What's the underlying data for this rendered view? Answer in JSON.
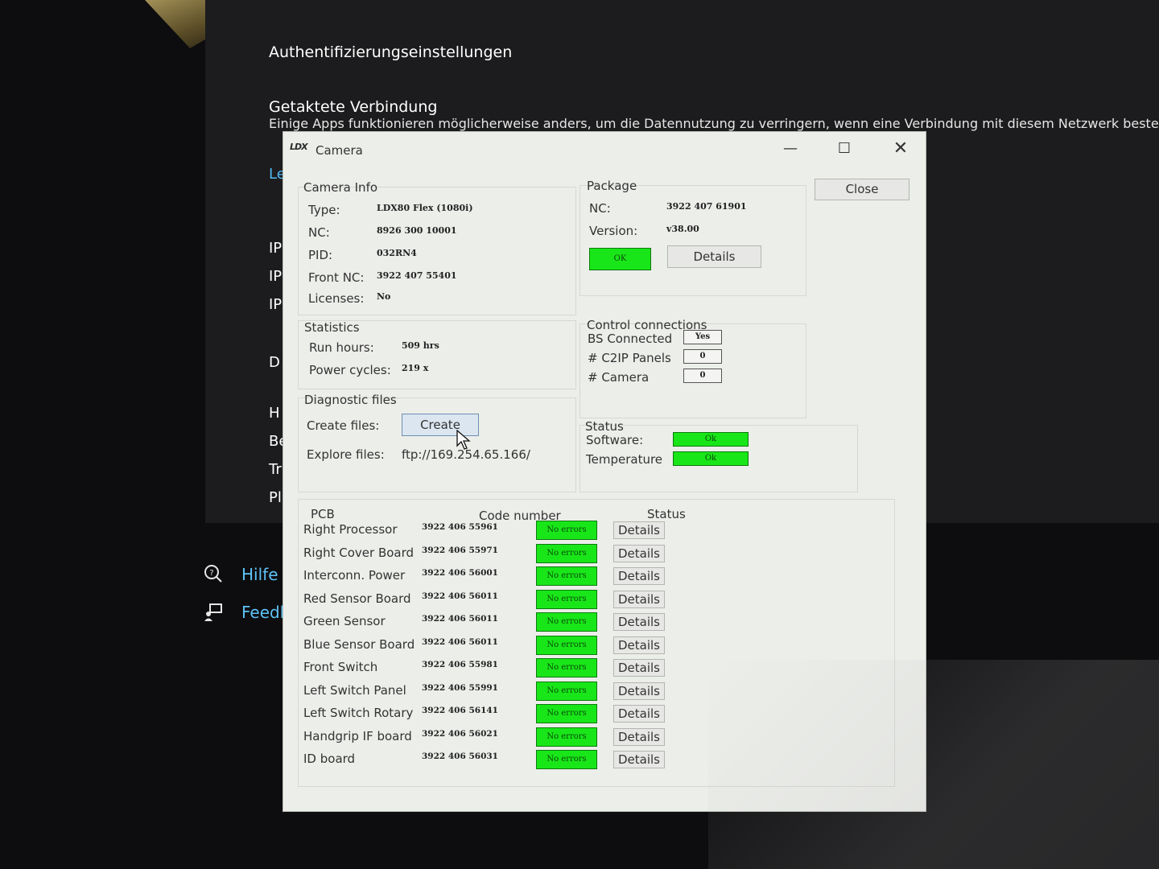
{
  "background": {
    "heading_auth": "Authentifizierungseinstellungen",
    "heading_metered": "Getaktete Verbindung",
    "metered_desc": "Einige Apps funktionieren möglicherweise anders, um die Datennutzung zu verringern, wenn eine Verbindung mit diesem Netzwerk besteht.",
    "side_items": [
      "Le",
      "IP",
      "IP",
      "IP",
      "D",
      "H",
      "Be",
      "Tr",
      "Pl"
    ],
    "help_link": "Hilfe a",
    "feedback_link": "Feedb"
  },
  "window": {
    "logo": "LDX",
    "title": "Camera",
    "minimize": "—",
    "maximize": "☐",
    "close": "✕"
  },
  "close_button": "Close",
  "camera_info": {
    "title": "Camera Info",
    "fields": [
      {
        "label": "Type:",
        "value": "LDX80 Flex (1080i)"
      },
      {
        "label": "NC:",
        "value": "8926 300 10001"
      },
      {
        "label": "PID:",
        "value": "032RN4"
      },
      {
        "label": "Front NC:",
        "value": "3922 407 55401"
      },
      {
        "label": "Licenses:",
        "value": "No"
      }
    ]
  },
  "package": {
    "title": "Package",
    "nc_label": "NC:",
    "nc_value": "3922 407 61901",
    "version_label": "Version:",
    "version_value": "v38.00",
    "status": "OK",
    "details": "Details"
  },
  "statistics": {
    "title": "Statistics",
    "run_hours_label": "Run hours:",
    "run_hours_value": "509 hrs",
    "power_cycles_label": "Power cycles:",
    "power_cycles_value": "219 x"
  },
  "control_connections": {
    "title": "Control connections",
    "bs_label": "BS Connected",
    "bs_value": "Yes",
    "c2ip_label": "# C2IP Panels",
    "c2ip_value": "0",
    "camera_label": "# Camera",
    "camera_value": "0"
  },
  "diagnostic": {
    "title": "Diagnostic files",
    "create_label": "Create files:",
    "create_button": "Create",
    "explore_label": "Explore files:",
    "explore_value": "ftp://169.254.65.166/"
  },
  "status": {
    "title": "Status",
    "software_label": "Software:",
    "software_value": "Ok",
    "temperature_label": "Temperature",
    "temperature_value": "Ok"
  },
  "pcb": {
    "col_pcb": "PCB",
    "col_code": "Code number",
    "col_status": "Status",
    "details_label": "Details",
    "rows": [
      {
        "name": "Right Processor",
        "code": "3922 406 55961",
        "status": "No errors"
      },
      {
        "name": "Right Cover Board",
        "code": "3922 406 55971",
        "status": "No errors"
      },
      {
        "name": "Interconn. Power",
        "code": "3922 406 56001",
        "status": "No errors"
      },
      {
        "name": "Red Sensor Board",
        "code": "3922 406 56011",
        "status": "No errors"
      },
      {
        "name": "Green Sensor",
        "code": "3922 406 56011",
        "status": "No errors"
      },
      {
        "name": "Blue Sensor Board",
        "code": "3922 406 56011",
        "status": "No errors"
      },
      {
        "name": "Front Switch",
        "code": "3922 406 55981",
        "status": "No errors"
      },
      {
        "name": "Left Switch Panel",
        "code": "3922 406 55991",
        "status": "No errors"
      },
      {
        "name": "Left Switch Rotary",
        "code": "3922 406 56141",
        "status": "No errors"
      },
      {
        "name": "Handgrip IF board",
        "code": "3922 406 56021",
        "status": "No errors"
      },
      {
        "name": "ID board",
        "code": "3922 406 56031",
        "status": "No errors"
      }
    ]
  }
}
